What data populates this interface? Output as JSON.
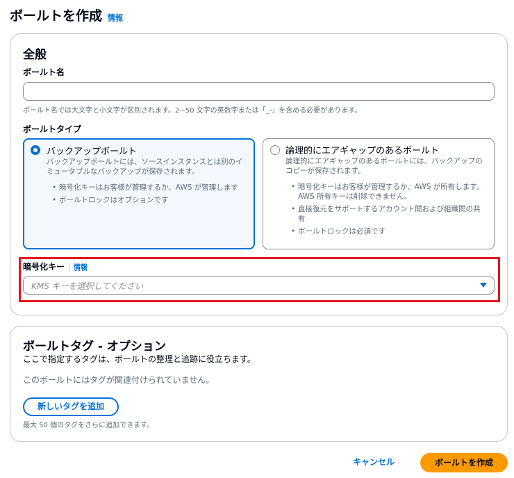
{
  "page": {
    "title": "ボールトを作成",
    "info_link": "情報"
  },
  "general": {
    "heading": "全般",
    "vault_name": {
      "label": "ボールト名",
      "value": "",
      "placeholder": "",
      "hint": "ボールト名では大文字と小文字が区別されます。2~50 文字の英数字または「_-」を含める必要があります。"
    },
    "vault_type": {
      "label": "ボールトタイプ",
      "options": [
        {
          "title": "バックアップボールト",
          "selected": true,
          "description": "バックアップボールトには、ソースインスタンスとは別のイミュータブルなバックアップが保存されます。",
          "bullets": [
            "暗号化キーはお客様が管理するか、AWS が管理します",
            "ボールトロックはオプションです"
          ]
        },
        {
          "title": "論理的にエアギャップのあるボールト",
          "selected": false,
          "description": "論理的にエアギャップのあるボールトには、バックアップのコピーが保存されます。",
          "bullets": [
            "暗号化キーはお客様が管理するか、AWS が所有します。AWS 所有キーは削除できません。",
            "直接復元をサポートするアカウント間および組織間の共有",
            "ボールトロックは必須です"
          ]
        }
      ]
    },
    "encryption_key": {
      "label": "暗号化キー",
      "info_link": "情報",
      "placeholder": "KMS キーを選択してください"
    }
  },
  "tags": {
    "heading": "ボールトタグ - オプション",
    "description": "ここで指定するタグは、ボールトの整理と追跡に役立ちます。",
    "empty_message": "このボールトにはタグが関連付けられていません。",
    "add_button": "新しいタグを追加",
    "limit_hint": "最大 50 個のタグをさらに追加できます。"
  },
  "footer": {
    "cancel_label": "キャンセル",
    "create_label": "ボールトを作成"
  },
  "colors": {
    "accent": "#0972d3",
    "primary_button": "#ff9900",
    "highlight_border": "#e5141e"
  }
}
